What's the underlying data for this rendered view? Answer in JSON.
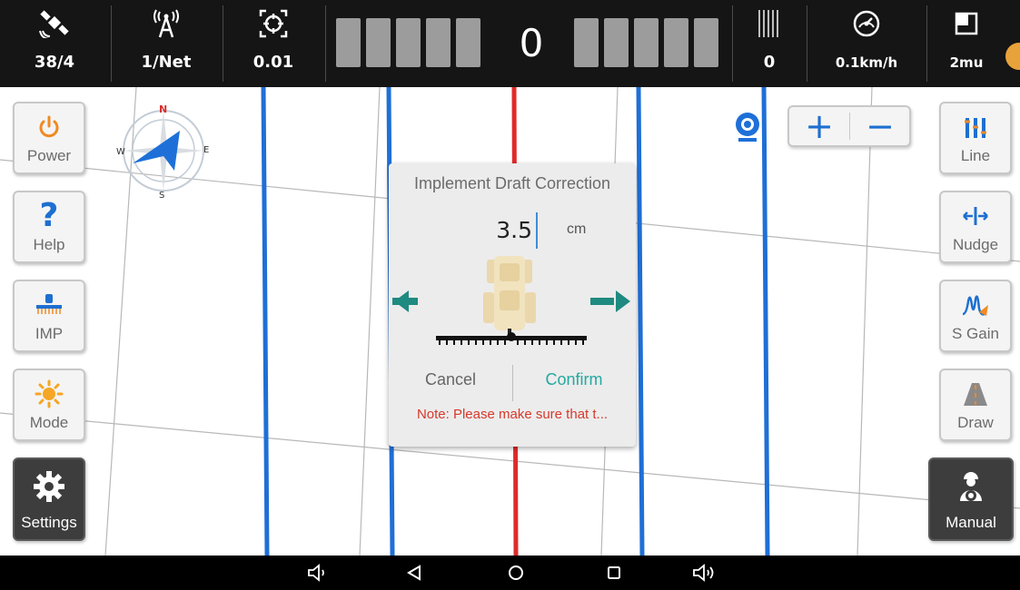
{
  "status_bar": {
    "satellites": {
      "icon": "satellite-icon",
      "value": "38/4"
    },
    "rtk": {
      "icon": "antenna-signal-icon",
      "value": "1/Net"
    },
    "accuracy": {
      "icon": "target-icon",
      "value": "0.01"
    },
    "lightbar": {
      "offset": "0",
      "left_segments": 5,
      "right_segments": 5,
      "segment_color": "#9c9c9c"
    },
    "row": {
      "icon": "rows-icon",
      "value": "0"
    },
    "speed": {
      "icon": "speedometer-icon",
      "value": "0.1km/h"
    },
    "area": {
      "icon": "area-icon",
      "value": "2mu"
    }
  },
  "left_toolbar": [
    {
      "name": "power",
      "label": "Power",
      "icon": "power-icon"
    },
    {
      "name": "help",
      "label": "Help",
      "icon": "help-icon"
    },
    {
      "name": "imp",
      "label": "IMP",
      "icon": "implement-icon"
    },
    {
      "name": "mode",
      "label": "Mode",
      "icon": "sun-icon"
    },
    {
      "name": "settings",
      "label": "Settings",
      "icon": "gear-icon"
    }
  ],
  "right_toolbar": [
    {
      "name": "line",
      "label": "Line",
      "icon": "line-icon"
    },
    {
      "name": "nudge",
      "label": "Nudge",
      "icon": "nudge-icon"
    },
    {
      "name": "s-gain",
      "label": "S Gain",
      "icon": "gain-icon"
    },
    {
      "name": "draw",
      "label": "Draw",
      "icon": "road-icon"
    },
    {
      "name": "manual",
      "label": "Manual",
      "icon": "driver-icon"
    }
  ],
  "compass": {
    "n": "N",
    "e": "E",
    "s": "S",
    "w": "W"
  },
  "zoom": {
    "in": "+",
    "out": "−"
  },
  "dialog": {
    "title": "Implement Draft Correction",
    "value": "3.5",
    "unit": "cm",
    "cancel": "Cancel",
    "confirm": "Confirm",
    "note": "Note: Please make sure that t..."
  },
  "colors": {
    "guidance_line": "#1f6fd6",
    "center_line": "#e02a2a",
    "arrow": "#1f8a80",
    "confirm": "#25a8a0",
    "note": "#d8382c",
    "topbar": "#151515"
  },
  "nav_bar": [
    "volume-down-icon",
    "back-icon",
    "home-icon",
    "recents-icon",
    "volume-up-icon"
  ]
}
